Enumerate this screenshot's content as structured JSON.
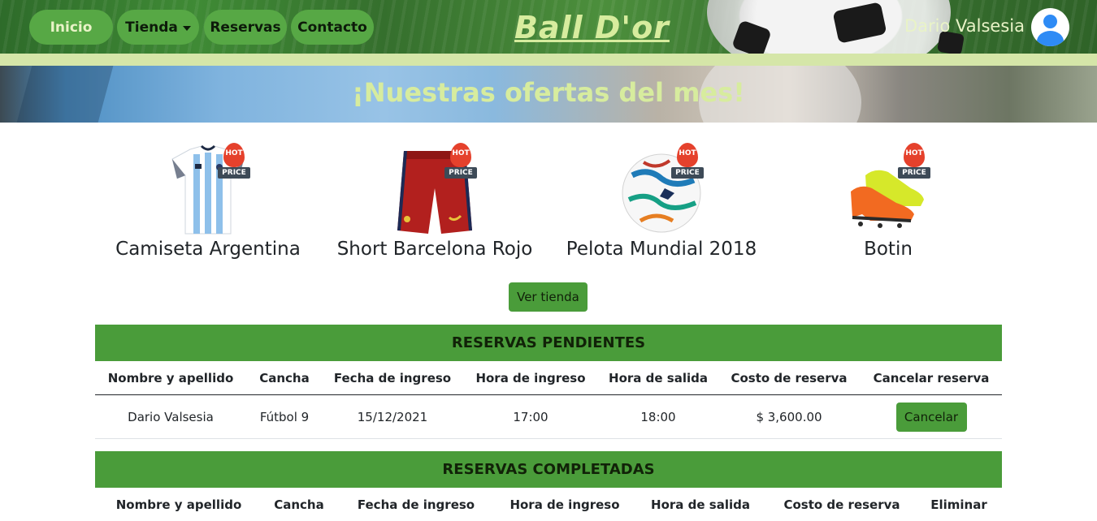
{
  "nav": {
    "items": [
      {
        "label": "Inicio"
      },
      {
        "label": "Tienda"
      },
      {
        "label": "Reservas"
      },
      {
        "label": "Contacto"
      }
    ],
    "brand": "Ball D'or",
    "user_name": "Dario Valsesia"
  },
  "banner": {
    "title": "¡Nuestras ofertas del mes!"
  },
  "products": [
    {
      "name": "Camiseta Argentina",
      "badge_top": "HOT",
      "badge_bottom": "PRICE"
    },
    {
      "name": "Short Barcelona Rojo",
      "badge_top": "HOT",
      "badge_bottom": "PRICE"
    },
    {
      "name": "Pelota Mundial 2018",
      "badge_top": "HOT",
      "badge_bottom": "PRICE"
    },
    {
      "name": "Botin",
      "badge_top": "HOT",
      "badge_bottom": "PRICE"
    }
  ],
  "shop_button": "Ver tienda",
  "pending": {
    "title": "RESERVAS PENDIENTES",
    "headers": [
      "Nombre y apellido",
      "Cancha",
      "Fecha de ingreso",
      "Hora de ingreso",
      "Hora de salida",
      "Costo de reserva",
      "Cancelar reserva"
    ],
    "rows": [
      {
        "name": "Dario Valsesia",
        "court": "Fútbol 9",
        "date": "15/12/2021",
        "start": "17:00",
        "end": "18:00",
        "cost": "$ 3,600.00",
        "action": "Cancelar"
      }
    ]
  },
  "completed": {
    "title": "RESERVAS COMPLETADAS",
    "headers": [
      "Nombre y apellido",
      "Cancha",
      "Fecha de ingreso",
      "Hora de ingreso",
      "Hora de salida",
      "Costo de reserva",
      "Eliminar"
    ]
  },
  "colors": {
    "accent_green": "#4a9c3a",
    "nav_pill": "#57a845",
    "brand_text": "#d7ec9e",
    "stripe": "#d5e6a8"
  }
}
